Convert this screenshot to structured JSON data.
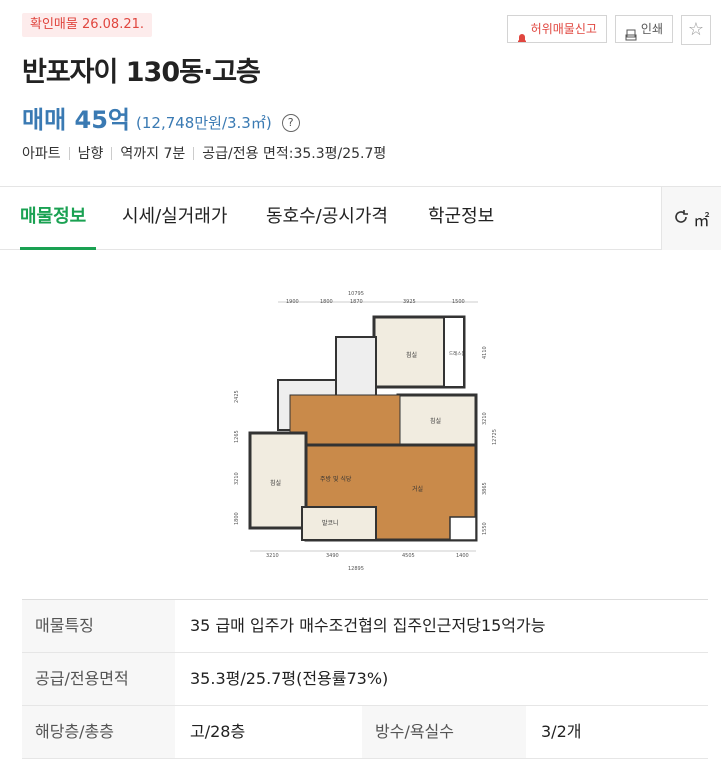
{
  "badge": {
    "confirm": "확인매물 26.08.21."
  },
  "actions": {
    "report": "허위매물신고",
    "print": "인쇄"
  },
  "listing": {
    "title": "반포자이 130동·고층",
    "price": "매매 45억",
    "unit_price": "(12,748만원/3.3㎡)",
    "help_symbol": "?"
  },
  "summary": [
    "아파트",
    "남향",
    "역까지 7분",
    "공급/전용 면적:35.3평/25.7평"
  ],
  "tabs": [
    "매물정보",
    "시세/실거래가",
    "동호수/공시가격",
    "학군정보"
  ],
  "unit_toggle": "㎡",
  "floorplan": {
    "rooms": [
      "침실",
      "침실",
      "침실",
      "주방 및 식당",
      "거실",
      "발코니"
    ],
    "dims_top": [
      "10795",
      "1900",
      "1800",
      "1870",
      "3925",
      "1500"
    ],
    "dims_bottom": [
      "3210",
      "3490",
      "4505",
      "1400",
      "12895"
    ],
    "dims_left": [
      "2425",
      "1265",
      "8475",
      "3210",
      "1800"
    ],
    "dims_right": [
      "4110",
      "3210",
      "12725",
      "3865",
      "1550"
    ],
    "closet": "드레스룸"
  },
  "details": {
    "features_label": "매물특징",
    "features_value": "35 급매 입주가 매수조건협의 집주인근저당15억가능",
    "area_label": "공급/전용면적",
    "area_value": "35.3평/25.7평(전용률73%)",
    "floor_label": "해당층/총층",
    "floor_value": "고/28층",
    "rooms_label": "방수/욕실수",
    "rooms_value": "3/2개"
  },
  "colors": {
    "accent": "#1aa152",
    "price": "#3a7ab3",
    "badge": "#e0463f"
  }
}
